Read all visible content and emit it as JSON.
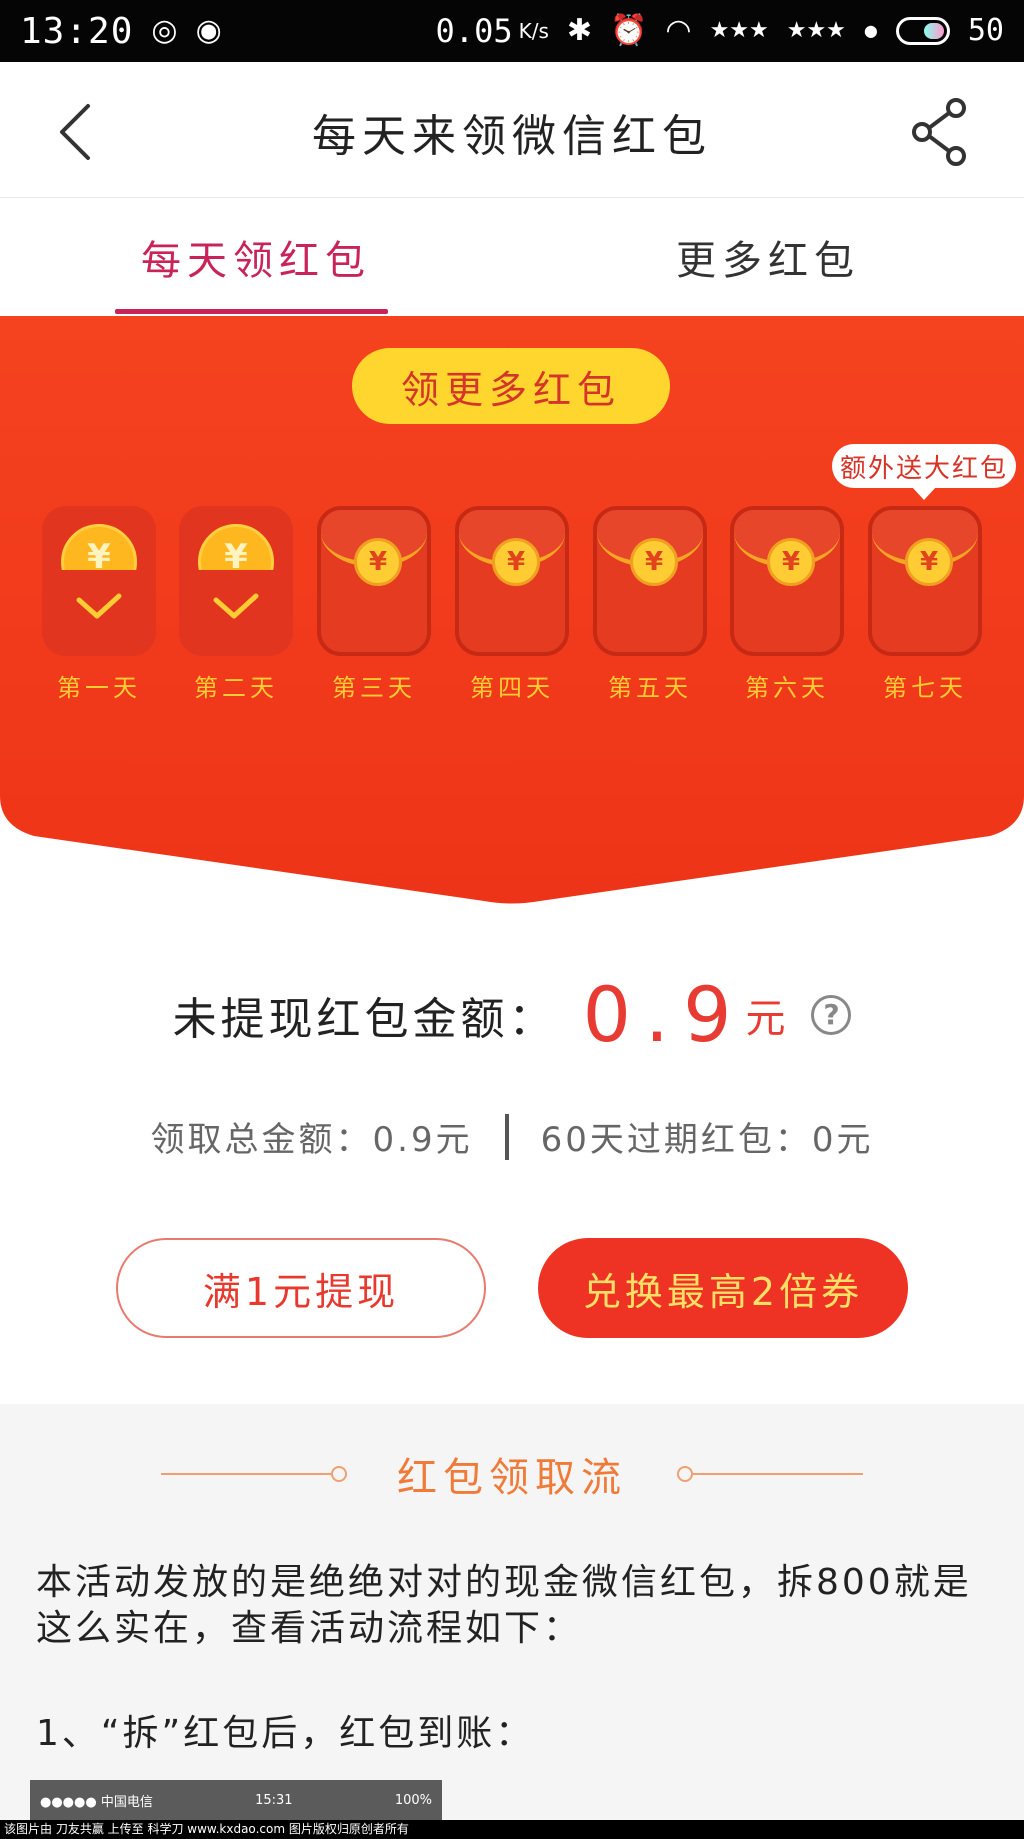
{
  "status_bar": {
    "time": "13:20",
    "speed": "0.05",
    "speed_unit": "K/s",
    "battery": "50"
  },
  "header": {
    "title": "每天来领微信红包",
    "back_icon": "chevron-left-icon",
    "share_icon": "share-icon"
  },
  "tabs": [
    {
      "label": "每天领红包",
      "active": true
    },
    {
      "label": "更多红包",
      "active": false
    }
  ],
  "hero": {
    "more_button": "领更多红包",
    "extra_bubble": "额外送大红包",
    "days": [
      {
        "label": "第一天",
        "state": "opened"
      },
      {
        "label": "第二天",
        "state": "opened"
      },
      {
        "label": "第三天",
        "state": "closed"
      },
      {
        "label": "第四天",
        "state": "closed"
      },
      {
        "label": "第五天",
        "state": "closed"
      },
      {
        "label": "第六天",
        "state": "closed"
      },
      {
        "label": "第七天",
        "state": "closed"
      }
    ],
    "coin_symbol": "¥"
  },
  "balance": {
    "label": "未提现红包金额：",
    "value": "0.9",
    "unit": "元",
    "help": "?",
    "total_label": "领取总金额：0.9元",
    "expiring_label": "60天过期红包：0元"
  },
  "actions": {
    "withdraw": "满1元提现",
    "exchange": "兑换最高2倍券"
  },
  "flow": {
    "title": "红包领取流",
    "intro": "本活动发放的是绝绝对对的现金微信红包，拆800就是这么实在，查看活动流程如下：",
    "step1": "1、“拆”红包后，红包到账：",
    "embed_carrier": "●●●●● 中国电信",
    "embed_time": "15:31",
    "embed_battery": "100%"
  },
  "watermark": "该图片由 刀友共赢 上传至 科学刀 www.kxdao.com 图片版权归原创者所有",
  "colors": {
    "accent_tab": "#c8245a",
    "hero_red": "#f0401e",
    "pill_yellow": "#ffd62e",
    "amount_red": "#e83b33",
    "flow_orange": "#f07a38"
  }
}
